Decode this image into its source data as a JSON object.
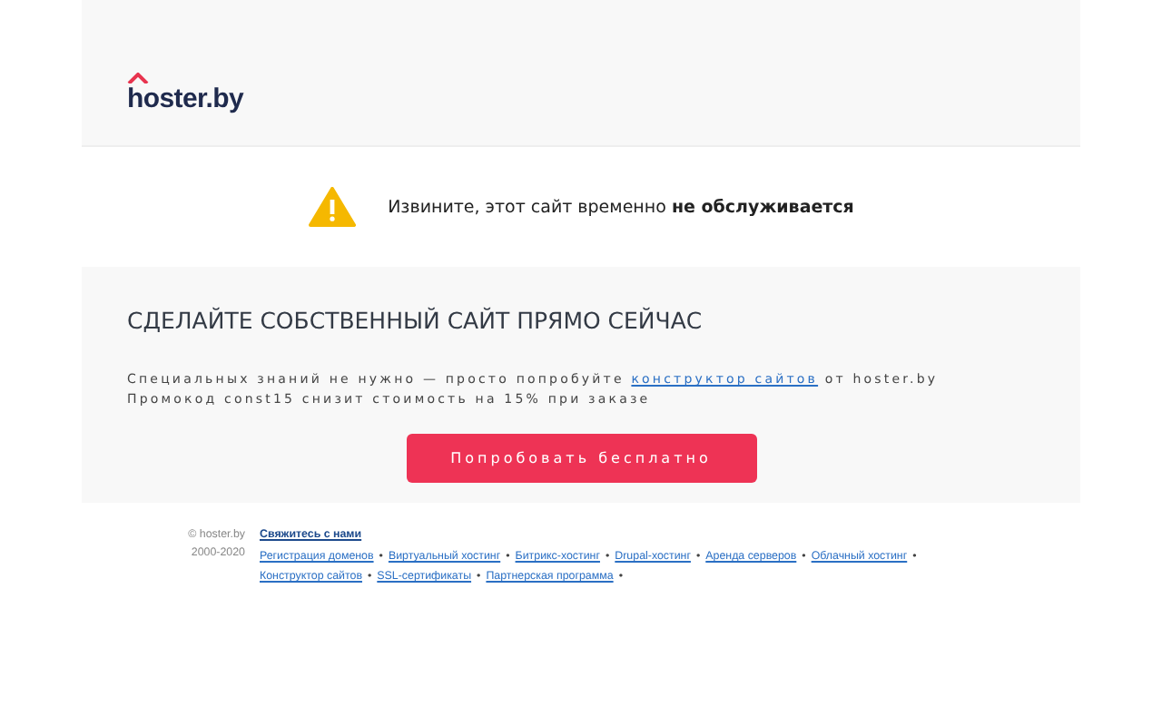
{
  "header": {
    "logo": "hoster.by"
  },
  "notice": {
    "text": "Извините, этот сайт временно **не обслуживается**"
  },
  "promo": {
    "title": "СДЕЛАЙТЕ СОБСТВЕННЫЙ САЙТ ПРЯМО СЕЙЧАС",
    "line1_before": "Специальных знаний не нужно — просто попробуйте",
    "line1_link": "конструктор сайтов",
    "line1_after": "от hoster.by",
    "line2": "Промокод const15 снизит стоимость на 15% при заказе",
    "button": "Попробовать бесплатно"
  },
  "footer": {
    "copyright": "© hoster.by",
    "years": "2000-2020",
    "contact": "Свяжитесь с нами",
    "links": [
      {
        "label": "Регистрация доменов",
        "sep": "•"
      },
      {
        "label": "Виртуальный хостинг",
        "sep": "•"
      },
      {
        "label": "Битрикс-хостинг",
        "sep": "•"
      },
      {
        "label": "Drupal-хостинг",
        "sep": "•"
      },
      {
        "label": "Аренда серверов",
        "sep": "•"
      },
      {
        "label": "Облачный хостинг",
        "sep": "•"
      },
      {
        "label": "Конструктор сайтов",
        "sep": "•"
      },
      {
        "label": "SSL-сертификаты",
        "sep": "•"
      },
      {
        "label": "Партнерская программа",
        "sep": "•"
      }
    ]
  }
}
